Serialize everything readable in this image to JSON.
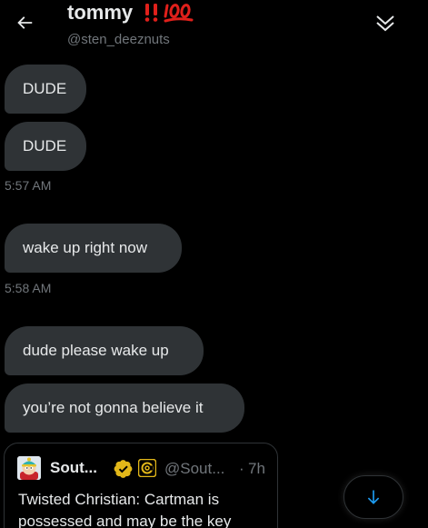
{
  "header": {
    "title": "tommy",
    "title_emoji": "‼️💯",
    "handle": "@sten_deeznuts"
  },
  "messages": [
    {
      "text": "DUDE"
    },
    {
      "text": "DUDE"
    },
    {
      "text": "wake up right now"
    },
    {
      "text": "dude please wake up"
    },
    {
      "text": "you’re not gonna believe it"
    }
  ],
  "timestamps": [
    "5:57 AM",
    "5:58 AM"
  ],
  "shared_post": {
    "name": "Sout...",
    "handle": "@Sout...",
    "separator": "·",
    "time": "7h",
    "text": "Twisted Christian: Cartman is possessed and may be the key"
  },
  "icons": {
    "back": "arrow-left-icon",
    "collapse": "double-chevron-down-icon",
    "verified": "verified-badge-icon",
    "org": "comedy-central-icon",
    "scroll": "arrow-down-icon"
  },
  "colors": {
    "background": "#000000",
    "bubble": "#2f3336",
    "text": "#e7e9ea",
    "secondary": "#71767b",
    "accent": "#1d9bf0",
    "verified": "#e2b719"
  }
}
